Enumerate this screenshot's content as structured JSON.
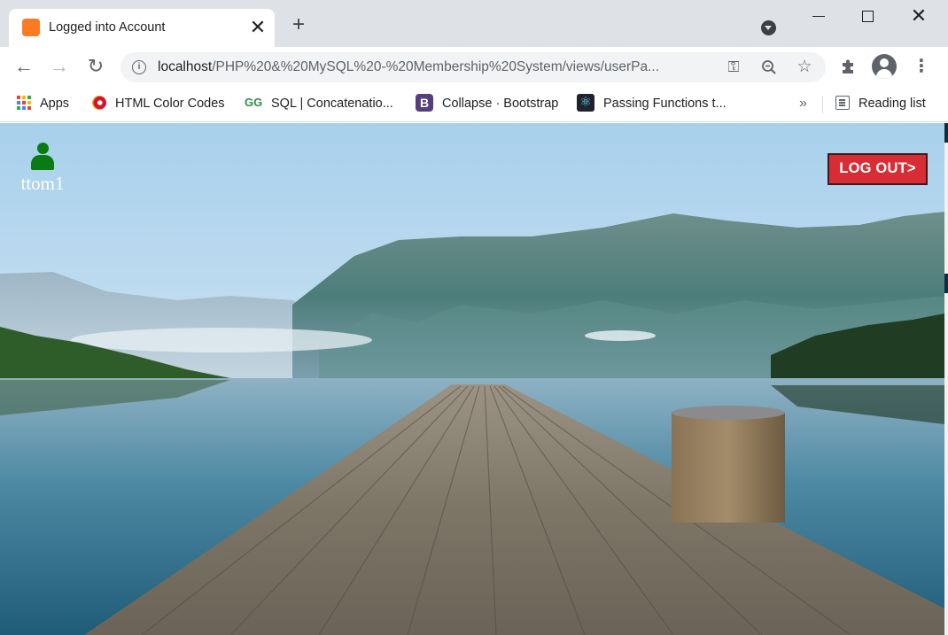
{
  "browser": {
    "tab": {
      "title": "Logged into Account",
      "close_glyph": "✕",
      "favicon": "xampp-icon"
    },
    "new_tab_glyph": "+",
    "window_controls": {
      "close_glyph": "✕"
    },
    "nav": {
      "back_glyph": "←",
      "forward_glyph": "→",
      "reload_glyph": "↻"
    },
    "address": {
      "host": "localhost",
      "path": "/PHP%20&%20MySQL%20-%20Membership%20System/views/userPa..."
    },
    "icons": {
      "key": "key-icon",
      "zoom": "zoom-icon",
      "star": "star-icon",
      "extensions": "puzzle-icon",
      "profile": "profile-icon",
      "menu": "more-vert-icon"
    }
  },
  "bookmarks": {
    "items": [
      {
        "label": "Apps",
        "icon": "apps-grid-icon"
      },
      {
        "label": "HTML Color Codes",
        "icon": "html-color-codes-icon"
      },
      {
        "label": "SQL | Concatenatio...",
        "icon": "geeksforgeeks-icon"
      },
      {
        "label": "Collapse · Bootstrap",
        "icon": "bootstrap-icon"
      },
      {
        "label": "Passing Functions t...",
        "icon": "react-icon"
      }
    ],
    "overflow_glyph": "»",
    "reading_list": "Reading list"
  },
  "page": {
    "user": {
      "name": "ttom1",
      "icon": "user-icon",
      "icon_color": "#0a7a12"
    },
    "logout_label": "LOG OUT>",
    "logout_color": "#d82d35",
    "background": "mountain-lake-pier-photo"
  },
  "colors": {
    "tabstrip": "#dee1e6",
    "apps_grid": [
      "#ea4335",
      "#fbbc05",
      "#34a853",
      "#4285f4",
      "#ea4335",
      "#fbbc05",
      "#34a853",
      "#4285f4",
      "#ea4335"
    ]
  }
}
